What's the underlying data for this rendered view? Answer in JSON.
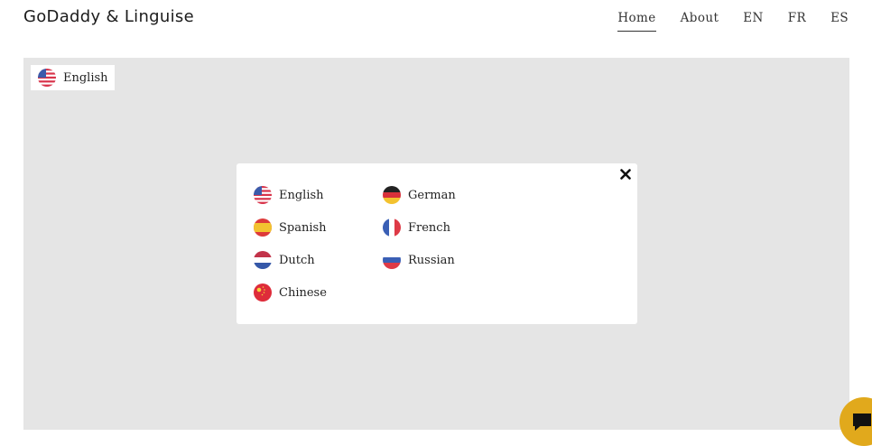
{
  "header": {
    "site_title": "GoDaddy & Linguise",
    "nav": [
      {
        "label": "Home",
        "active": true
      },
      {
        "label": "About",
        "active": false
      },
      {
        "label": "EN",
        "active": false
      },
      {
        "label": "FR",
        "active": false
      },
      {
        "label": "ES",
        "active": false
      }
    ]
  },
  "language_switcher": {
    "current_label": "English",
    "current_flag": "us-flag-icon"
  },
  "language_modal": {
    "close_icon": "close-icon",
    "languages": [
      {
        "label": "English",
        "flag": "us-flag-icon"
      },
      {
        "label": "Spanish",
        "flag": "spain-flag-icon"
      },
      {
        "label": "Dutch",
        "flag": "netherlands-flag-icon"
      },
      {
        "label": "Chinese",
        "flag": "china-flag-icon"
      },
      {
        "label": "German",
        "flag": "germany-flag-icon"
      },
      {
        "label": "French",
        "flag": "france-flag-icon"
      },
      {
        "label": "Russian",
        "flag": "russia-flag-icon"
      }
    ]
  },
  "chat": {
    "icon": "chat-icon",
    "color": "#e1a91c"
  },
  "colors": {
    "stage_background": "#e5e5e5",
    "accent": "#e1a91c"
  }
}
